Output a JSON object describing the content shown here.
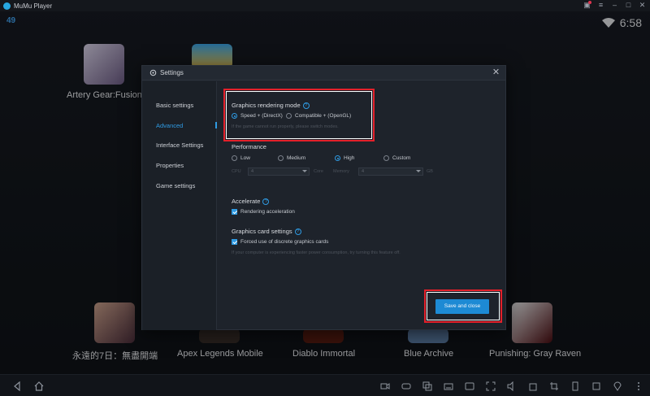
{
  "window": {
    "title": "MuMu Player"
  },
  "status": {
    "fps": "49",
    "time": "6:58"
  },
  "desktop_apps": [
    {
      "name": "Artery Gear:Fusion",
      "icon": "artery-gear-icon"
    },
    {
      "name": "",
      "icon": "stumble-guys-icon"
    }
  ],
  "dock_apps": [
    {
      "name": "永遠的7日：無盡開端"
    },
    {
      "name": "Apex Legends Mobile"
    },
    {
      "name": "Diablo Immortal"
    },
    {
      "name": "Blue Archive"
    },
    {
      "name": "Punishing: Gray Raven"
    }
  ],
  "dialog": {
    "title": "Settings",
    "nav": [
      {
        "label": "Basic settings"
      },
      {
        "label": "Advanced",
        "active": true
      },
      {
        "label": "Interface Settings"
      },
      {
        "label": "Properties"
      },
      {
        "label": "Game settings"
      }
    ],
    "rendering": {
      "label": "Graphics rendering mode",
      "options": [
        {
          "label": "Speed + (DirectX)",
          "selected": true
        },
        {
          "label": "Compatible + (OpenGL)",
          "selected": false
        }
      ],
      "hint": "If the game cannot run properly, please switch modes."
    },
    "performance": {
      "label": "Performance",
      "options": [
        {
          "label": "Low",
          "selected": false
        },
        {
          "label": "Medium",
          "selected": false
        },
        {
          "label": "High",
          "selected": true
        },
        {
          "label": "Custom",
          "selected": false
        }
      ],
      "cpu_label": "CPU",
      "cpu_value": "4",
      "core_label": "Core",
      "memory_label": "Memory",
      "memory_value": "4",
      "gb_label": "GB"
    },
    "accelerate": {
      "label": "Accelerate",
      "checkbox": "Rendering acceleration",
      "checked": true
    },
    "graphics_card": {
      "label": "Graphics card settings",
      "checkbox": "Forced use of discrete graphics cards",
      "checked": true,
      "hint": "If your computer is experiencing faster power consumption, try turning this feature off."
    },
    "save_button": "Save and close"
  },
  "colors": {
    "accent": "#2f9be3",
    "button": "#1d8ad4",
    "highlight": "#e4202a",
    "dialog_bg": "#1e232b"
  }
}
